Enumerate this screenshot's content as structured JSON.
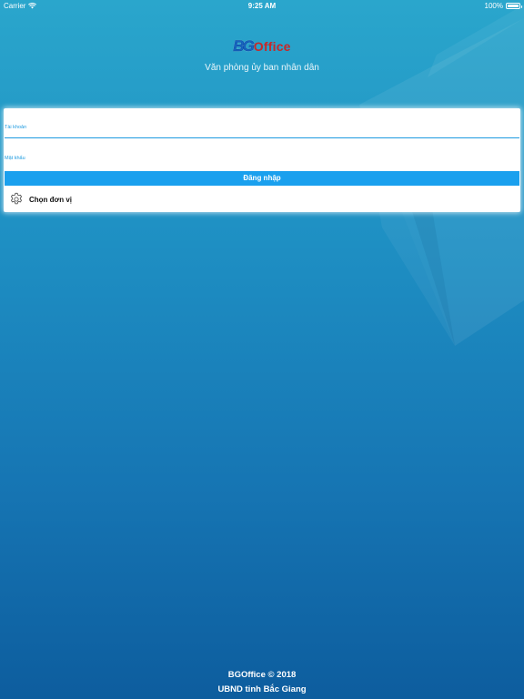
{
  "status_bar": {
    "carrier": "Carrier",
    "time": "9:25 AM",
    "battery": "100%",
    "battery_level": 1.0,
    "wifi_icon": "wifi-icon",
    "battery_icon": "battery-icon"
  },
  "logo": {
    "mark": "BG",
    "text": "Office",
    "mark_color": "#1565c0",
    "text_color": "#c62828"
  },
  "subtitle": "Văn phòng ủy ban nhân dân",
  "login": {
    "username_label": "Tài khoản",
    "password_label": "Mật khẩu",
    "login_button": "Đăng nhập",
    "select_unit": "Chọn đơn vị",
    "accent_color": "#1aa0ee"
  },
  "footer": {
    "copyright": "BGOffice © 2018",
    "organization": "UBND tỉnh Bắc Giang"
  }
}
